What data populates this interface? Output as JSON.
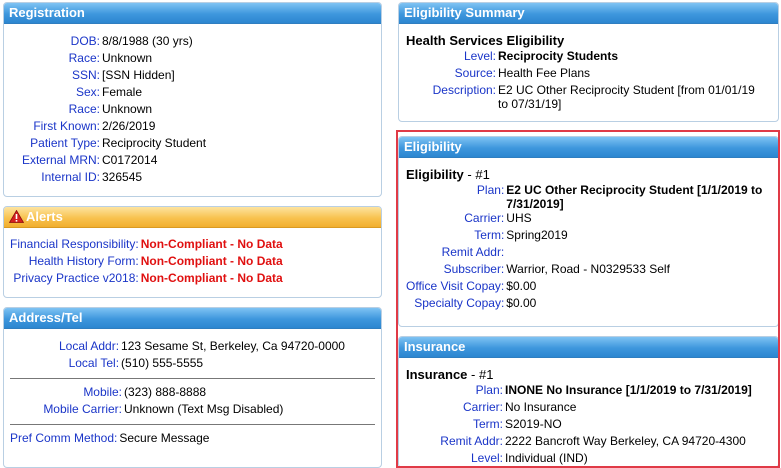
{
  "registration": {
    "title": "Registration",
    "rows": [
      {
        "label": "DOB:",
        "value": "8/8/1988 (30 yrs)"
      },
      {
        "label": "Race:",
        "value": "Unknown"
      },
      {
        "label": "SSN:",
        "value": "[SSN Hidden]"
      },
      {
        "label": "Sex:",
        "value": "Female"
      },
      {
        "label": "Race:",
        "value": "Unknown"
      },
      {
        "label": "First Known:",
        "value": "2/26/2019"
      },
      {
        "label": "Patient Type:",
        "value": "Reciprocity Student"
      },
      {
        "label": "External MRN:",
        "value": "C0172014"
      },
      {
        "label": "Internal ID:",
        "value": "326545"
      }
    ]
  },
  "alerts": {
    "title": "Alerts",
    "icon": "warning-icon",
    "rows": [
      {
        "label": "Financial Responsibility:",
        "value": "Non-Compliant - No Data"
      },
      {
        "label": "Health History Form:",
        "value": "Non-Compliant - No Data"
      },
      {
        "label": "Privacy Practice v2018:",
        "value": "Non-Compliant - No Data"
      }
    ]
  },
  "address": {
    "title": "Address/Tel",
    "local_addr_label": "Local Addr:",
    "local_addr": "123 Sesame St, Berkeley, Ca 94720-0000",
    "local_tel_label": "Local Tel:",
    "local_tel": "(510) 555-5555",
    "mobile_label": "Mobile:",
    "mobile": "(323) 888-8888",
    "mobile_carrier_label": "Mobile Carrier:",
    "mobile_carrier": "Unknown (Text Msg Disabled)",
    "pref_label": "Pref Comm Method:",
    "pref": "Secure Message"
  },
  "eligibility_summary": {
    "title": "Eligibility Summary",
    "subtitle": "Health Services Eligibility",
    "level_label": "Level:",
    "level": "Reciprocity Students",
    "source_label": "Source:",
    "source": "Health Fee Plans",
    "description_label": "Description:",
    "description_line1": "E2 UC Other Reciprocity Student [from 01/01/19",
    "description_line2": "to 07/31/19]"
  },
  "eligibility": {
    "title": "Eligibility",
    "subtitle": "Eligibility",
    "number": " - #1",
    "plan_label": "Plan:",
    "plan_line1": "E2 UC Other Reciprocity Student [1/1/2019 to",
    "plan_line2": "7/31/2019]",
    "carrier_label": "Carrier:",
    "carrier": "UHS",
    "term_label": "Term:",
    "term": "Spring2019",
    "remit_label": "Remit Addr:",
    "remit": "",
    "subscriber_label": "Subscriber:",
    "subscriber": "Warrior, Road - N0329533 Self",
    "office_copay_label": "Office Visit Copay:",
    "office_copay": "$0.00",
    "specialty_copay_label": "Specialty Copay:",
    "specialty_copay": "$0.00"
  },
  "insurance": {
    "title": "Insurance",
    "subtitle": "Insurance",
    "number": " - #1",
    "plan_label": "Plan:",
    "plan": "INONE No Insurance [1/1/2019 to 7/31/2019]",
    "carrier_label": "Carrier:",
    "carrier": "No Insurance",
    "term_label": "Term:",
    "term": "S2019-NO",
    "remit_label": "Remit Addr:",
    "remit": "2222 Bancroft Way Berkeley, CA 94720-4300",
    "level_label": "Level:",
    "level": "Individual (IND)"
  },
  "colors": {
    "header_blue": "#3e97dd",
    "header_orange": "#f8c24f",
    "label_blue": "#1a35c8",
    "alert_red": "#e01010",
    "highlight_red": "#e03a46"
  }
}
